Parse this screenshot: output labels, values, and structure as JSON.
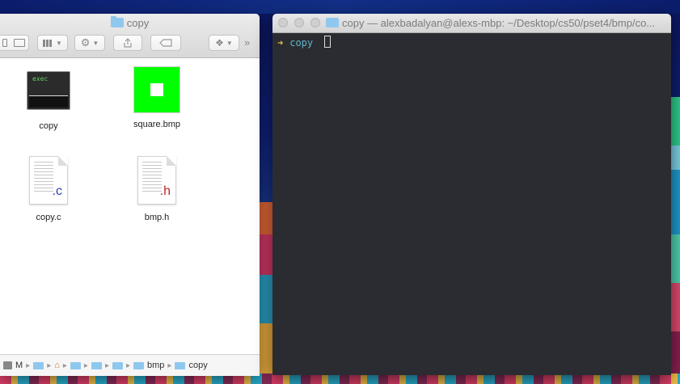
{
  "finder": {
    "title": "copy",
    "files": [
      {
        "name": "copy",
        "icon": "exec-icon",
        "badge": "exec"
      },
      {
        "name": "square.bmp",
        "icon": "bmp-icon"
      },
      {
        "name": "copy.c",
        "icon": "c-file-icon",
        "ext": ".c"
      },
      {
        "name": "bmp.h",
        "icon": "h-file-icon",
        "ext": ".h"
      }
    ],
    "pathbar": {
      "first": "M",
      "bmp": "bmp",
      "copy": "copy"
    }
  },
  "terminal": {
    "title": "copy — alexbadalyan@alexs-mbp: ~/Desktop/cs50/pset4/bmp/co...",
    "prompt_arrow": "➜",
    "prompt_dir": "copy"
  },
  "colors": {
    "terminal_bg": "#2b2c31",
    "prompt_arrow": "#e3c54a",
    "prompt_dir": "#5fb6c9",
    "bmp_green": "#00ff00",
    "c_ext": "#2b3fb0",
    "h_ext": "#c0262b"
  }
}
